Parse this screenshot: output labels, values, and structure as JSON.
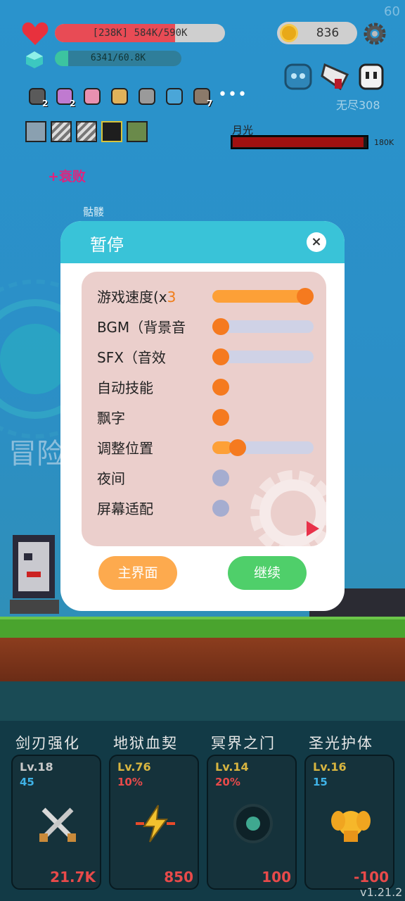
{
  "hud": {
    "hp_text": "[238K] 584K/590K",
    "hp_fraction": 0.705,
    "xp_text": "6341/60.8K",
    "xp_fraction": 0.104,
    "coins": "836",
    "fps": "60"
  },
  "items": [
    {
      "icon": "sword-icon",
      "count": "2"
    },
    {
      "icon": "potted-plant-icon",
      "count": "2"
    },
    {
      "icon": "dessert-icon",
      "count": ""
    },
    {
      "icon": "scroll-icon",
      "count": ""
    },
    {
      "icon": "hammer-icon",
      "count": ""
    },
    {
      "icon": "magnifier-icon",
      "count": ""
    },
    {
      "icon": "meteor-icon",
      "count": "7"
    }
  ],
  "more": "•••",
  "endless_label": "无尽308",
  "boss": {
    "name": "月光",
    "hp_text": "180K",
    "hp_fraction": 0.98
  },
  "status_text": "+衰败",
  "enemy_label": "骷髅",
  "background_text": "冒险",
  "dialog": {
    "title": "暂停",
    "close_icon": "×",
    "rows": [
      {
        "label": "游戏速度(x",
        "highlight": "3",
        "type": "slider",
        "value": 1.0
      },
      {
        "label": "BGM（背景音",
        "highlight": "",
        "type": "slider",
        "value": 0.0
      },
      {
        "label": "SFX（音效",
        "highlight": "",
        "type": "slider",
        "value": 0.0
      },
      {
        "label": "自动技能",
        "highlight": "",
        "type": "toggle",
        "value": true
      },
      {
        "label": "飘字",
        "highlight": "",
        "type": "toggle",
        "value": true
      },
      {
        "label": "调整位置",
        "highlight": "",
        "type": "slider",
        "value": 0.2
      },
      {
        "label": "夜间",
        "highlight": "",
        "type": "toggle",
        "value": false
      },
      {
        "label": "屏幕适配",
        "highlight": "",
        "type": "toggle",
        "value": false
      }
    ],
    "main_button": "主界面",
    "continue_button": "继续"
  },
  "skills": [
    {
      "title": "剑刃强化",
      "level": "Lv.18",
      "sub": "45",
      "sub_color": "#3fb2e6",
      "cost": "21.7K",
      "icon": "crossed-swords-icon"
    },
    {
      "title": "地狱血契",
      "level": "Lv.76",
      "sub": "10%",
      "sub_color": "#e84a4a",
      "cost": "850",
      "icon": "lightning-icon"
    },
    {
      "title": "冥界之门",
      "level": "Lv.14",
      "sub": "20%",
      "sub_color": "#e84a4a",
      "cost": "100",
      "icon": "portal-icon"
    },
    {
      "title": "圣光护体",
      "level": "Lv.16",
      "sub": "15",
      "sub_color": "#3fb2e6",
      "cost": "-100",
      "icon": "angel-icon"
    }
  ],
  "version": "v1.21.2"
}
